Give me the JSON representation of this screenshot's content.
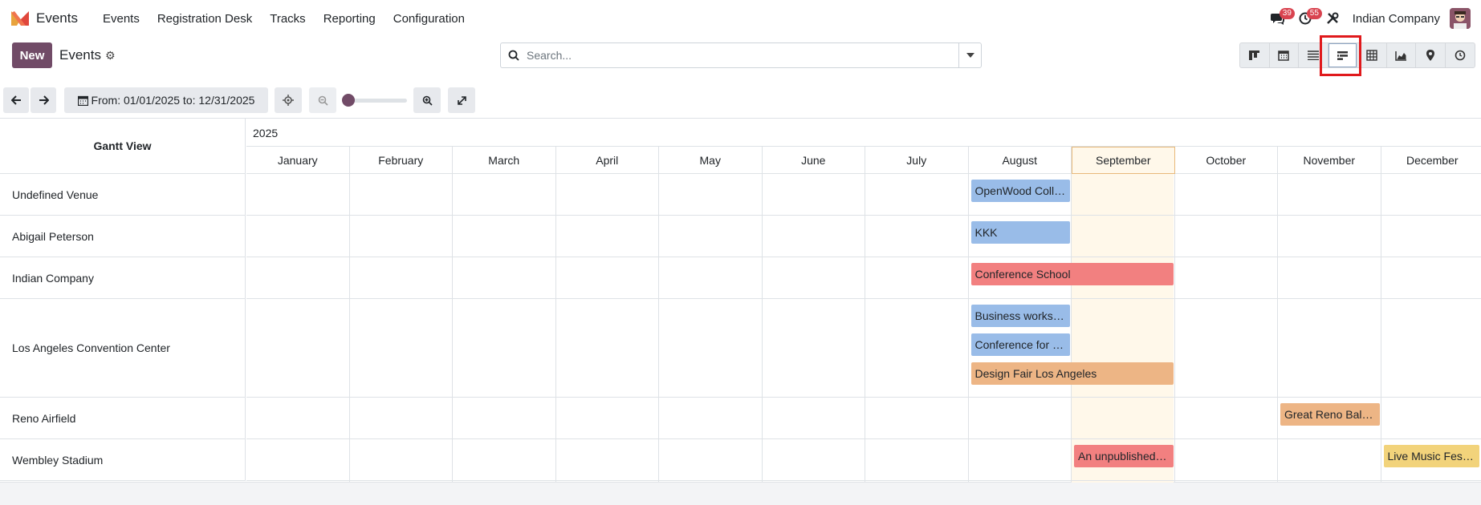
{
  "app": {
    "name": "Events"
  },
  "menu": [
    "Events",
    "Registration Desk",
    "Tracks",
    "Reporting",
    "Configuration"
  ],
  "systray": {
    "messages_count": "39",
    "activities_count": "55",
    "company": "Indian Company"
  },
  "control": {
    "new_label": "New",
    "title": "Events"
  },
  "search": {
    "placeholder": "Search..."
  },
  "views": [
    "kanban-view-icon",
    "calendar-view-icon",
    "list-view-icon",
    "gantt-view-icon",
    "pivot-view-icon",
    "graph-view-icon",
    "map-view-icon",
    "activity-view-icon"
  ],
  "active_view": "gantt",
  "toolbar": {
    "date_range": "From: 01/01/2025 to: 12/31/2025"
  },
  "gantt": {
    "title": "Gantt View",
    "year": "2025",
    "months": [
      "January",
      "February",
      "March",
      "April",
      "May",
      "June",
      "July",
      "August",
      "September",
      "October",
      "November",
      "December"
    ],
    "rows": [
      {
        "label": "Undefined Venue",
        "pills": [
          {
            "text": "OpenWood Coll…",
            "color": "#99bce8"
          }
        ]
      },
      {
        "label": "Abigail Peterson",
        "pills": [
          {
            "text": "KKK",
            "color": "#99bce8"
          }
        ]
      },
      {
        "label": "Indian Company",
        "pills": [
          {
            "text": "Conference School",
            "color": "#f28080"
          }
        ]
      },
      {
        "label": "Los Angeles Convention Center",
        "pills": [
          {
            "text": "Business works…",
            "color": "#99bce8"
          },
          {
            "text": "Conference for …",
            "color": "#99bce8"
          },
          {
            "text": "Design Fair Los Angeles",
            "color": "#edb585"
          }
        ]
      },
      {
        "label": "Reno Airfield",
        "pills": [
          {
            "text": "Great Reno Ball…",
            "color": "#edb585"
          }
        ]
      },
      {
        "label": "Wembley Stadium",
        "pills": [
          {
            "text": "An unpublished…",
            "color": "#f28080"
          },
          {
            "text": "Live Music Festi…",
            "color": "#f2d37b"
          }
        ]
      }
    ]
  },
  "colors": {
    "primary": "#714b67",
    "today": "#fff8ea",
    "highlight": "#e0191c"
  }
}
